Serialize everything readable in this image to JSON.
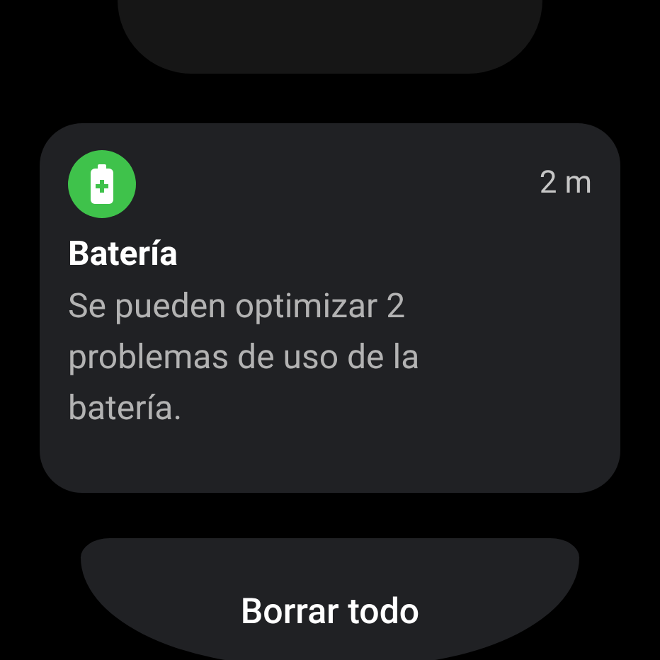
{
  "notification": {
    "app": "Batería",
    "time": "2 m",
    "message": "Se pueden optimizar 2 problemas de uso de la batería."
  },
  "clear_button": {
    "label": "Borrar todo"
  }
}
